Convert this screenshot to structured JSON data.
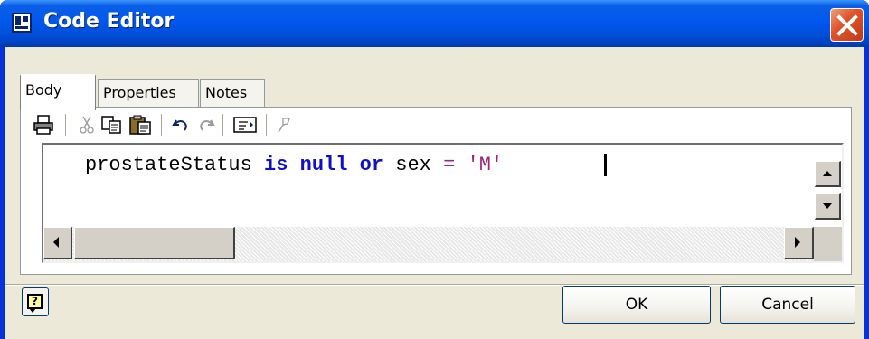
{
  "window": {
    "title": "Code Editor",
    "titlebar_color": "#0058ee",
    "icon": "code-editor-window-icon",
    "close_icon": "close-x-icon"
  },
  "tabs": [
    {
      "label": "Body",
      "active": true
    },
    {
      "label": "Properties",
      "active": false
    },
    {
      "label": "Notes",
      "active": false
    }
  ],
  "toolbar": {
    "icons": [
      "print-icon",
      "cut-icon",
      "copy-icon",
      "paste-icon",
      "undo-icon",
      "redo-icon",
      "insert-field-icon",
      "pin-icon"
    ],
    "disabled": [
      "cut-icon",
      "redo-icon",
      "pin-icon"
    ]
  },
  "editor": {
    "tokens": [
      {
        "text": "prostateStatus ",
        "kind": "identifier"
      },
      {
        "text": "is",
        "kind": "keyword"
      },
      {
        "text": " ",
        "kind": "space"
      },
      {
        "text": "null",
        "kind": "keyword"
      },
      {
        "text": " ",
        "kind": "space"
      },
      {
        "text": "or",
        "kind": "keyword"
      },
      {
        "text": " sex ",
        "kind": "identifier"
      },
      {
        "text": "=",
        "kind": "operator"
      },
      {
        "text": " ",
        "kind": "space"
      },
      {
        "text": "'M'",
        "kind": "string"
      }
    ],
    "keyword_color": "#1010c8",
    "string_color": "#a0247c"
  },
  "buttons": {
    "ok": "OK",
    "cancel": "Cancel",
    "help_icon": "help-question-icon"
  }
}
